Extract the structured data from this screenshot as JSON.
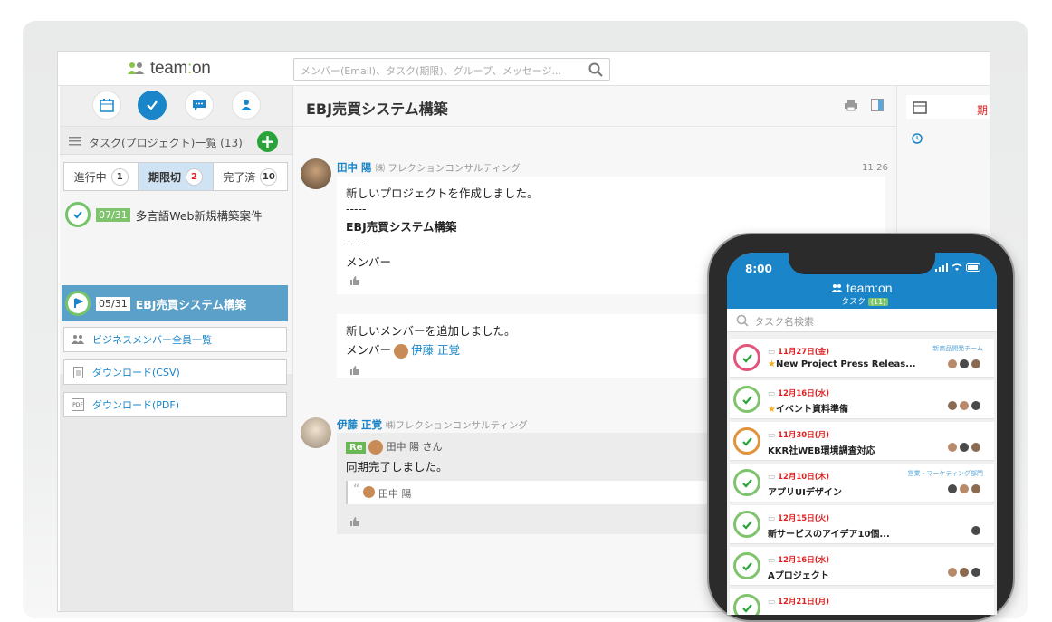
{
  "header": {
    "logo": "team:on",
    "search_placeholder": "メンバー(Email)、タスク(期限)、グループ、メッセージ..."
  },
  "sidebar": {
    "list_title": "タスク(プロジェクト)一覧 (13)",
    "tabs": [
      {
        "label": "進行中",
        "count": "1"
      },
      {
        "label": "期限切",
        "count": "2"
      },
      {
        "label": "完了済",
        "count": "10"
      }
    ],
    "tasks": [
      {
        "date": "07/31",
        "name": "多言語Web新規構築案件"
      },
      {
        "date": "05/31",
        "name": "EBJ売買システム構築"
      }
    ],
    "links": [
      {
        "label": "ビジネスメンバー全員一覧",
        "icon": "members-icon"
      },
      {
        "label": "ダウンロード(CSV)",
        "icon": "csv-file-icon"
      },
      {
        "label": "ダウンロード(PDF)",
        "icon": "pdf-file-icon",
        "icon_text": "PDF"
      }
    ]
  },
  "main": {
    "title": "EBJ売買システム構築",
    "messages": [
      {
        "sender": "田中 陽",
        "company": "㈱ フレクションコンサルティング",
        "time": "11:26",
        "lines": [
          "新しいプロジェクトを作成しました。",
          "-----",
          "EBJ売買システム構築",
          "-----",
          "メンバー"
        ]
      },
      {
        "lines": [
          "新しいメンバーを追加しました。",
          "メンバー"
        ],
        "member_name": "伊藤 正覚"
      },
      {
        "sender": "伊藤 正覚",
        "company": "㈱フレクションコンサルティング",
        "re_label": "Re",
        "re_to": "田中 陽 さん",
        "body": "同期完了しました。",
        "quote_name": "田中 陽"
      }
    ]
  },
  "right_panel": {
    "label": "期"
  },
  "phone": {
    "time": "8:00",
    "logo": "team:on",
    "subtitle": "タスク",
    "subtitle_count": "(11)",
    "search_placeholder": "タスク名検索",
    "items": [
      {
        "date": "11月27日(金)",
        "title": "New Project Press Releas...",
        "star": true,
        "group": "新商品開発チーム",
        "status": "pink"
      },
      {
        "date": "12月16日(水)",
        "title": "イベント資料準備",
        "star": true,
        "group": "",
        "status": "green"
      },
      {
        "date": "11月30日(月)",
        "title": "KKR社WEB環境調査対応",
        "star": false,
        "group": "",
        "status": "orange"
      },
      {
        "date": "12月10日(木)",
        "title": "アプリUIデザイン",
        "star": false,
        "group": "営業・マーケティング部門",
        "status": "green"
      },
      {
        "date": "12月15日(火)",
        "title": "新サービスのアイデア10個...",
        "star": false,
        "group": "",
        "status": "green"
      },
      {
        "date": "12月16日(水)",
        "title": "Aプロジェクト",
        "star": false,
        "group": "",
        "status": "green"
      },
      {
        "date": "12月21日(月)",
        "title": "",
        "star": false,
        "group": "",
        "status": "green"
      }
    ]
  },
  "colors": {
    "accent": "#1a85c8",
    "green": "#7fc46d",
    "alert": "#e02020"
  }
}
